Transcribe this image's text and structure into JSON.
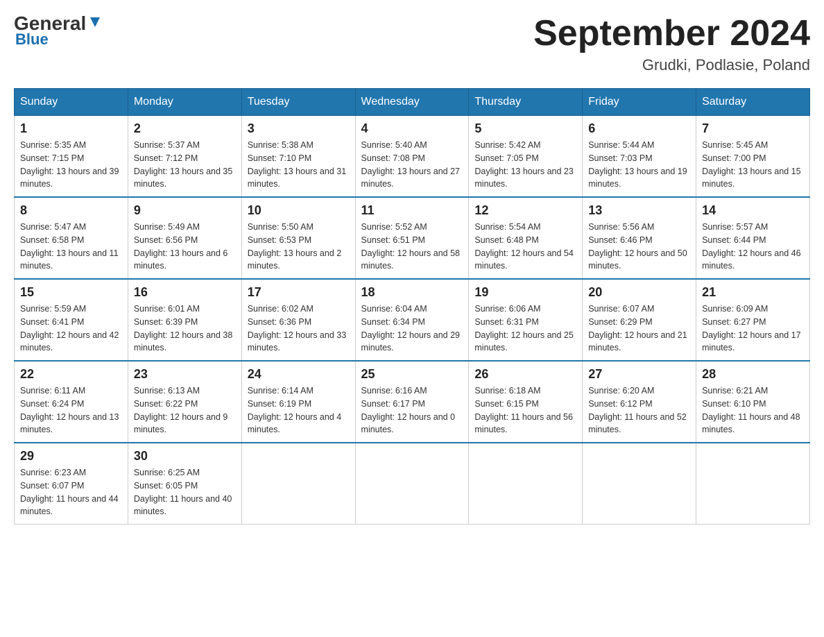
{
  "header": {
    "logo_general": "General",
    "logo_blue": "Blue",
    "month_title": "September 2024",
    "location": "Grudki, Podlasie, Poland"
  },
  "days_of_week": [
    "Sunday",
    "Monday",
    "Tuesday",
    "Wednesday",
    "Thursday",
    "Friday",
    "Saturday"
  ],
  "weeks": [
    [
      {
        "day": "1",
        "sunrise": "5:35 AM",
        "sunset": "7:15 PM",
        "daylight": "13 hours and 39 minutes."
      },
      {
        "day": "2",
        "sunrise": "5:37 AM",
        "sunset": "7:12 PM",
        "daylight": "13 hours and 35 minutes."
      },
      {
        "day": "3",
        "sunrise": "5:38 AM",
        "sunset": "7:10 PM",
        "daylight": "13 hours and 31 minutes."
      },
      {
        "day": "4",
        "sunrise": "5:40 AM",
        "sunset": "7:08 PM",
        "daylight": "13 hours and 27 minutes."
      },
      {
        "day": "5",
        "sunrise": "5:42 AM",
        "sunset": "7:05 PM",
        "daylight": "13 hours and 23 minutes."
      },
      {
        "day": "6",
        "sunrise": "5:44 AM",
        "sunset": "7:03 PM",
        "daylight": "13 hours and 19 minutes."
      },
      {
        "day": "7",
        "sunrise": "5:45 AM",
        "sunset": "7:00 PM",
        "daylight": "13 hours and 15 minutes."
      }
    ],
    [
      {
        "day": "8",
        "sunrise": "5:47 AM",
        "sunset": "6:58 PM",
        "daylight": "13 hours and 11 minutes."
      },
      {
        "day": "9",
        "sunrise": "5:49 AM",
        "sunset": "6:56 PM",
        "daylight": "13 hours and 6 minutes."
      },
      {
        "day": "10",
        "sunrise": "5:50 AM",
        "sunset": "6:53 PM",
        "daylight": "13 hours and 2 minutes."
      },
      {
        "day": "11",
        "sunrise": "5:52 AM",
        "sunset": "6:51 PM",
        "daylight": "12 hours and 58 minutes."
      },
      {
        "day": "12",
        "sunrise": "5:54 AM",
        "sunset": "6:48 PM",
        "daylight": "12 hours and 54 minutes."
      },
      {
        "day": "13",
        "sunrise": "5:56 AM",
        "sunset": "6:46 PM",
        "daylight": "12 hours and 50 minutes."
      },
      {
        "day": "14",
        "sunrise": "5:57 AM",
        "sunset": "6:44 PM",
        "daylight": "12 hours and 46 minutes."
      }
    ],
    [
      {
        "day": "15",
        "sunrise": "5:59 AM",
        "sunset": "6:41 PM",
        "daylight": "12 hours and 42 minutes."
      },
      {
        "day": "16",
        "sunrise": "6:01 AM",
        "sunset": "6:39 PM",
        "daylight": "12 hours and 38 minutes."
      },
      {
        "day": "17",
        "sunrise": "6:02 AM",
        "sunset": "6:36 PM",
        "daylight": "12 hours and 33 minutes."
      },
      {
        "day": "18",
        "sunrise": "6:04 AM",
        "sunset": "6:34 PM",
        "daylight": "12 hours and 29 minutes."
      },
      {
        "day": "19",
        "sunrise": "6:06 AM",
        "sunset": "6:31 PM",
        "daylight": "12 hours and 25 minutes."
      },
      {
        "day": "20",
        "sunrise": "6:07 AM",
        "sunset": "6:29 PM",
        "daylight": "12 hours and 21 minutes."
      },
      {
        "day": "21",
        "sunrise": "6:09 AM",
        "sunset": "6:27 PM",
        "daylight": "12 hours and 17 minutes."
      }
    ],
    [
      {
        "day": "22",
        "sunrise": "6:11 AM",
        "sunset": "6:24 PM",
        "daylight": "12 hours and 13 minutes."
      },
      {
        "day": "23",
        "sunrise": "6:13 AM",
        "sunset": "6:22 PM",
        "daylight": "12 hours and 9 minutes."
      },
      {
        "day": "24",
        "sunrise": "6:14 AM",
        "sunset": "6:19 PM",
        "daylight": "12 hours and 4 minutes."
      },
      {
        "day": "25",
        "sunrise": "6:16 AM",
        "sunset": "6:17 PM",
        "daylight": "12 hours and 0 minutes."
      },
      {
        "day": "26",
        "sunrise": "6:18 AM",
        "sunset": "6:15 PM",
        "daylight": "11 hours and 56 minutes."
      },
      {
        "day": "27",
        "sunrise": "6:20 AM",
        "sunset": "6:12 PM",
        "daylight": "11 hours and 52 minutes."
      },
      {
        "day": "28",
        "sunrise": "6:21 AM",
        "sunset": "6:10 PM",
        "daylight": "11 hours and 48 minutes."
      }
    ],
    [
      {
        "day": "29",
        "sunrise": "6:23 AM",
        "sunset": "6:07 PM",
        "daylight": "11 hours and 44 minutes."
      },
      {
        "day": "30",
        "sunrise": "6:25 AM",
        "sunset": "6:05 PM",
        "daylight": "11 hours and 40 minutes."
      },
      null,
      null,
      null,
      null,
      null
    ]
  ],
  "labels": {
    "sunrise": "Sunrise:",
    "sunset": "Sunset:",
    "daylight": "Daylight:"
  }
}
